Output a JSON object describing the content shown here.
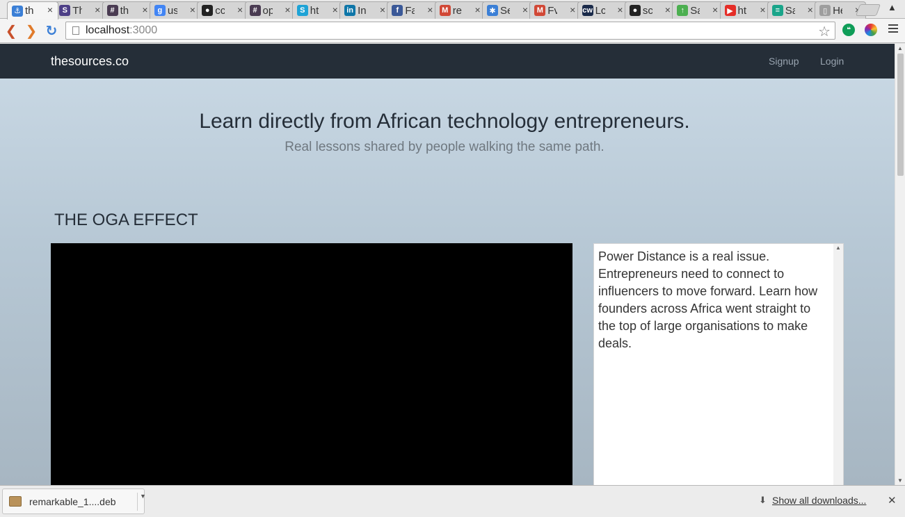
{
  "browser": {
    "tabs": [
      {
        "title": "th",
        "icon": "pin-icon",
        "color": "#3b7fd6",
        "active": true
      },
      {
        "title": "Th",
        "icon": "s-circle-icon",
        "color": "#4d3f87"
      },
      {
        "title": "th",
        "icon": "hash-icon",
        "color": "#4a3b52"
      },
      {
        "title": "us",
        "icon": "google-icon",
        "color": "#4285f4"
      },
      {
        "title": "cc",
        "icon": "github-icon",
        "color": "#222222"
      },
      {
        "title": "op",
        "icon": "hash-icon",
        "color": "#4a3b52"
      },
      {
        "title": "ht",
        "icon": "skype-icon",
        "color": "#1ea3d6"
      },
      {
        "title": "In",
        "icon": "linkedin-icon",
        "color": "#0e76a8"
      },
      {
        "title": "Fa",
        "icon": "facebook-icon",
        "color": "#3b5998"
      },
      {
        "title": "re",
        "icon": "gmail-icon",
        "color": "#d14836"
      },
      {
        "title": "Se",
        "icon": "asterisk-icon",
        "color": "#3b7fd6"
      },
      {
        "title": "Fv",
        "icon": "gmail-icon",
        "color": "#d14836"
      },
      {
        "title": "Lc",
        "icon": "cw-icon",
        "color": "#1a2a4a"
      },
      {
        "title": "sc",
        "icon": "github-icon",
        "color": "#222222"
      },
      {
        "title": "Sa",
        "icon": "tree-icon",
        "color": "#4caf50"
      },
      {
        "title": "ht",
        "icon": "youtube-icon",
        "color": "#e52d27"
      },
      {
        "title": "Sa",
        "icon": "sheet-icon",
        "color": "#1aa58a"
      },
      {
        "title": "He",
        "icon": "page-icon",
        "color": "#9e9e9e"
      }
    ],
    "url": {
      "host": "localhost",
      "port": ":3000"
    }
  },
  "site": {
    "brand": "thesources.co",
    "nav": {
      "signup": "Signup",
      "login": "Login"
    },
    "hero": {
      "title": "Learn directly from African technology entrepreneurs.",
      "subtitle": "Real lessons shared by people walking the same path."
    },
    "lesson": {
      "title": "THE OGA EFFECT",
      "description": "Power Distance is a real issue. Entrepreneurs need to connect to influencers to move forward. Learn how founders across Africa went straight to the top of large organisations to make deals."
    }
  },
  "downloads": {
    "item_name": "remarkable_1....deb",
    "show_all": "Show all downloads..."
  }
}
